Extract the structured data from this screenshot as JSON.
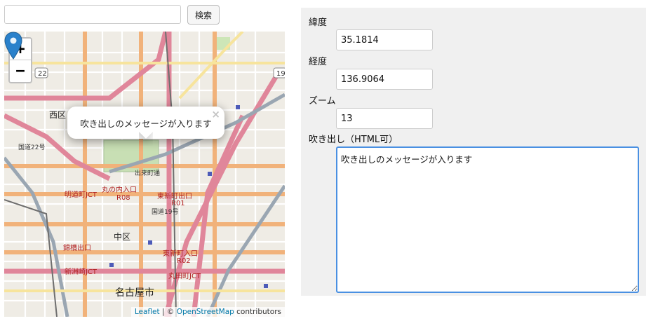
{
  "search": {
    "placeholder": "",
    "value": "",
    "button_label": "検索"
  },
  "map": {
    "zoom_in_label": "+",
    "zoom_out_label": "−",
    "popup_message": "吹き出しのメッセージが入ります",
    "popup_close": "×",
    "attribution": {
      "leaflet": "Leaflet",
      "separator": " | © ",
      "osm": "OpenStreetMap",
      "suffix": " contributors"
    },
    "labels": {
      "nishi_ku": "西区",
      "naka_ku": "中区",
      "nagoya_shi": "名古屋市",
      "marunouchi": "丸の内入口",
      "higashi_shinmachi": "東新町出口",
      "higashi_shinmachi2": "東新町入口",
      "demachi": "出来町通",
      "meijo": "明道町JCT",
      "nishiki_bashi": "錦橋出口",
      "shinsu_jct": "新洲崎JCT",
      "marutamachi": "丸田町JCT",
      "route22": "国道22号",
      "route19": "国道19号",
      "r08": "R08",
      "r01": "R01",
      "r02": "R02",
      "shield_22": "22",
      "shield_19": "19"
    }
  },
  "form": {
    "latitude": {
      "label": "緯度",
      "value": "35.1814"
    },
    "longitude": {
      "label": "経度",
      "value": "136.9064"
    },
    "zoom": {
      "label": "ズーム",
      "value": "13"
    },
    "balloon": {
      "label": "吹き出し（HTML可）",
      "value": "吹き出しのメッセージが入ります"
    }
  }
}
